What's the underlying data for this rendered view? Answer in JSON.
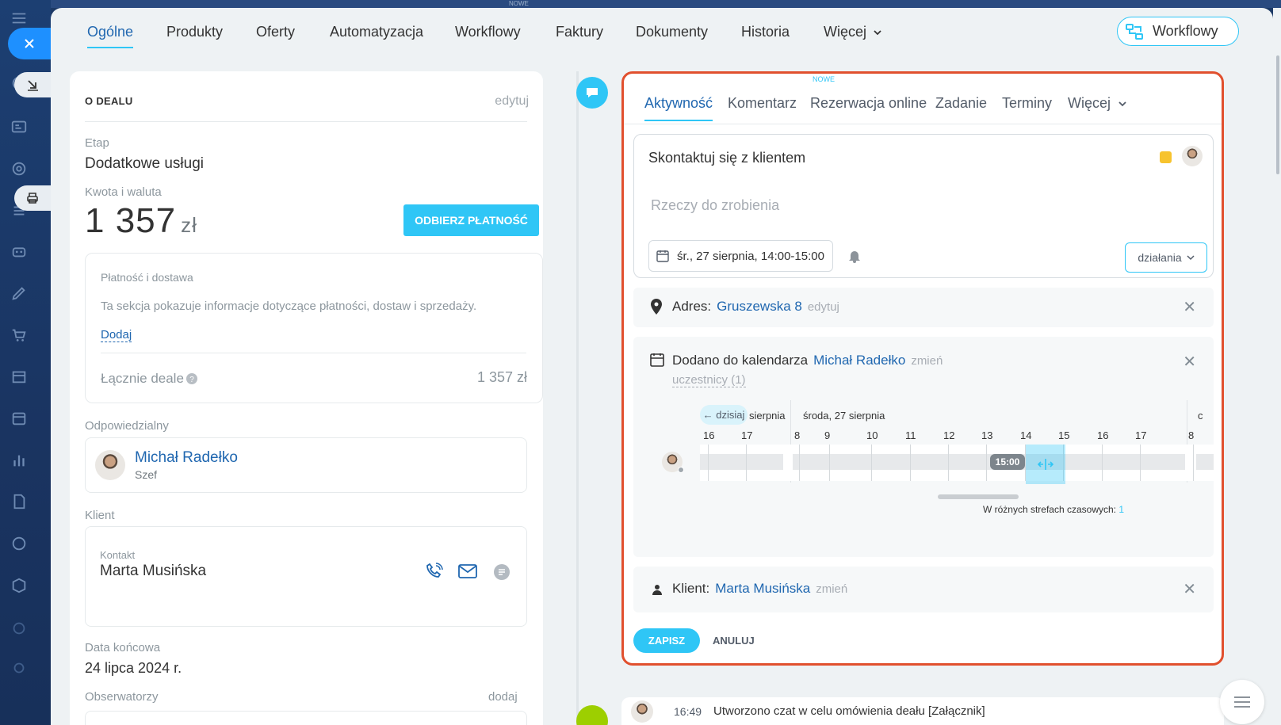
{
  "top_badge": "NOWE",
  "tabs": [
    {
      "label": "Ogólne",
      "active": true
    },
    {
      "label": "Produkty"
    },
    {
      "label": "Oferty"
    },
    {
      "label": "Automatyzacja"
    },
    {
      "label": "Workflowy"
    },
    {
      "label": "Faktury"
    },
    {
      "label": "Dokumenty"
    },
    {
      "label": "Historia"
    },
    {
      "label": "Więcej"
    }
  ],
  "workflow_button": "Workflowy",
  "deal": {
    "title": "O DEALU",
    "edit": "edytuj",
    "stage_label": "Etap",
    "stage_value": "Dodatkowe usługi",
    "amount_label": "Kwota i waluta",
    "amount": "1 357",
    "currency": "zł",
    "pay_button": "ODBIERZ PŁATNOŚĆ",
    "payment": {
      "title": "Płatność i dostawa",
      "desc": "Ta sekcja pokazuje informacje dotyczące płatności, dostaw i sprzedaży.",
      "add": "Dodaj",
      "total_label": "Łącznie deale",
      "total_value": "1 357 zł"
    },
    "responsible_label": "Odpowiedzialny",
    "responsible_name": "Michał Radełko",
    "responsible_role": "Szef",
    "client_label": "Klient",
    "contact_label": "Kontakt",
    "contact_name": "Marta Musińska",
    "end_date_label": "Data końcowa",
    "end_date": "24 lipca 2024 r.",
    "observers_label": "Obserwatorzy",
    "observers_add": "dodaj"
  },
  "activity": {
    "new_badge": "NOWE",
    "tabs": [
      {
        "label": "Aktywność",
        "active": true
      },
      {
        "label": "Komentarz"
      },
      {
        "label": "Rezerwacja online"
      },
      {
        "label": "Zadanie"
      },
      {
        "label": "Terminy"
      },
      {
        "label": "Więcej"
      }
    ],
    "task_title": "Skontaktuj się z klientem",
    "task_placeholder": "Rzeczy do zrobienia",
    "date": "śr., 27 sierpnia, 14:00-15:00",
    "actions": "działania",
    "address_label": "Adres:",
    "address_value": "Gruszewska 8",
    "address_edit": "edytuj",
    "calendar_label": "Dodano do kalendarza",
    "calendar_user": "Michał Radełko",
    "calendar_change": "zmień",
    "participants": "uczestnicy (1)",
    "today_btn": "← dzisiaj",
    "day_prev": "sierpnia",
    "day_current": "środa, 27 sierpnia",
    "day_next": "c",
    "hours": [
      "16",
      "17",
      "8",
      "9",
      "10",
      "11",
      "12",
      "13",
      "14",
      "15",
      "16",
      "17",
      "8"
    ],
    "time_badge": "15:00",
    "timezones_text": "W różnych strefach czasowych:",
    "timezones_count": "1",
    "client_label": "Klient:",
    "client_value": "Marta Musińska",
    "client_change": "zmień",
    "save": "ZAPISZ",
    "cancel": "ANULUJ"
  },
  "timeline_entry": {
    "time": "16:49",
    "text": "Utworzono czat w celu omówienia deału [Załącznik]"
  },
  "colors": {
    "accent": "#2fc6f6",
    "link": "#2067b0",
    "highlight_border": "#e1502e",
    "sidebar": "#1c3f72",
    "close": "#1e90ff",
    "timeline_green": "#9dcf00"
  }
}
